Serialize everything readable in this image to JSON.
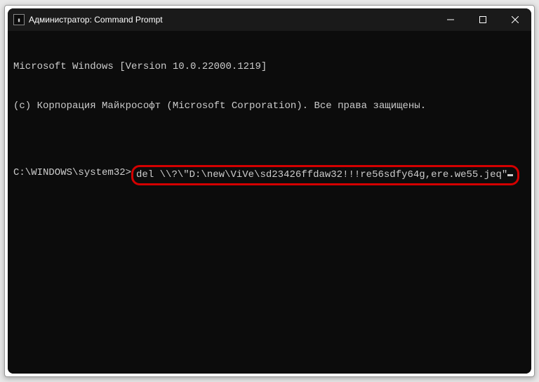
{
  "titlebar": {
    "icon_text": "C:\\",
    "title": "Администратор: Command Prompt"
  },
  "terminal": {
    "line1": "Microsoft Windows [Version 10.0.22000.1219]",
    "line2": "(c) Корпорация Майкрософт (Microsoft Corporation). Все права защищены.",
    "blank": "",
    "prompt": "C:\\WINDOWS\\system32>",
    "command": "del \\\\?\\\"D:\\new\\ViVe\\sd23426ffdaw32!!!re56sdfy64g,ere.we55.jeq\""
  }
}
